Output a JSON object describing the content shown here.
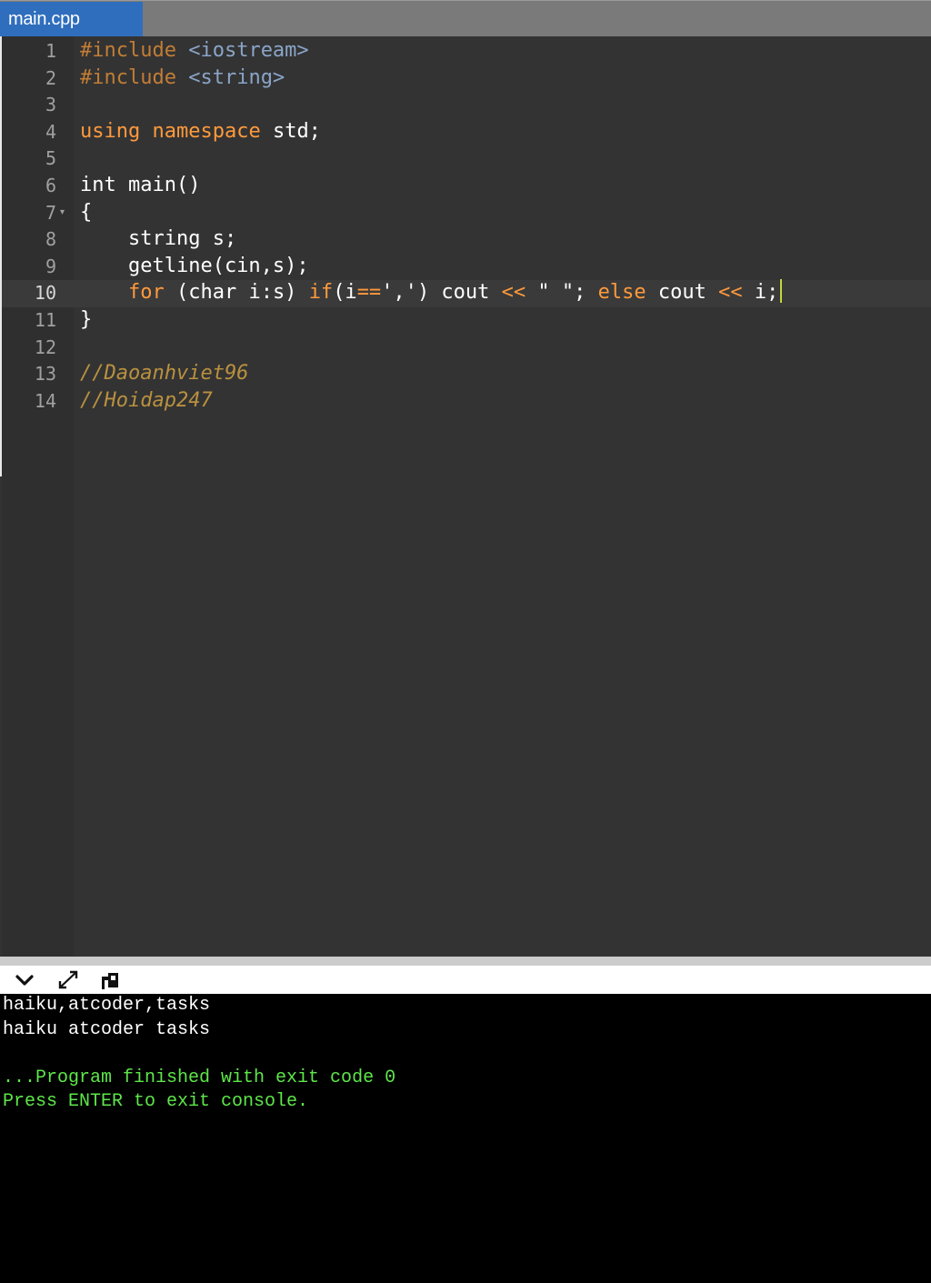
{
  "tab": {
    "title": "main.cpp"
  },
  "editor": {
    "lines": [
      {
        "num": "1",
        "tokens": [
          {
            "t": "#include ",
            "c": "tok-inc"
          },
          {
            "t": "<iostream>",
            "c": "tok-str"
          }
        ]
      },
      {
        "num": "2",
        "tokens": [
          {
            "t": "#include ",
            "c": "tok-inc"
          },
          {
            "t": "<string>",
            "c": "tok-str"
          }
        ]
      },
      {
        "num": "3",
        "tokens": []
      },
      {
        "num": "4",
        "tokens": [
          {
            "t": "using",
            "c": "tok-kw"
          },
          {
            "t": " ",
            "c": "tok-txt"
          },
          {
            "t": "namespace",
            "c": "tok-kw"
          },
          {
            "t": " std;",
            "c": "tok-txt"
          }
        ]
      },
      {
        "num": "5",
        "tokens": []
      },
      {
        "num": "6",
        "tokens": [
          {
            "t": "int main()",
            "c": "tok-txt"
          }
        ]
      },
      {
        "num": "7",
        "fold": "▾",
        "tokens": [
          {
            "t": "{",
            "c": "tok-txt"
          }
        ]
      },
      {
        "num": "8",
        "tokens": [
          {
            "t": "    string s;",
            "c": "tok-txt"
          }
        ]
      },
      {
        "num": "9",
        "tokens": [
          {
            "t": "    getline(cin,s);",
            "c": "tok-txt"
          }
        ]
      },
      {
        "num": "10",
        "active": true,
        "tokens": [
          {
            "t": "    ",
            "c": "tok-txt"
          },
          {
            "t": "for",
            "c": "tok-kw"
          },
          {
            "t": " (char i:s) ",
            "c": "tok-txt"
          },
          {
            "t": "if",
            "c": "tok-kw"
          },
          {
            "t": "(i",
            "c": "tok-txt"
          },
          {
            "t": "==",
            "c": "tok-op"
          },
          {
            "t": "','",
            "c": "tok-txt"
          },
          {
            "t": ") cout ",
            "c": "tok-txt"
          },
          {
            "t": "<<",
            "c": "tok-op"
          },
          {
            "t": " \" \"; ",
            "c": "tok-txt"
          },
          {
            "t": "else",
            "c": "tok-kw"
          },
          {
            "t": " cout ",
            "c": "tok-txt"
          },
          {
            "t": "<<",
            "c": "tok-op"
          },
          {
            "t": " i;",
            "c": "tok-txt"
          }
        ]
      },
      {
        "num": "11",
        "tokens": [
          {
            "t": "}",
            "c": "tok-txt"
          }
        ]
      },
      {
        "num": "12",
        "tokens": []
      },
      {
        "num": "13",
        "tokens": [
          {
            "t": "//Daoanhviet96",
            "c": "tok-comment"
          }
        ]
      },
      {
        "num": "14",
        "tokens": [
          {
            "t": "//Hoidap247",
            "c": "tok-comment"
          }
        ]
      }
    ]
  },
  "console_toolbar": {
    "icons": [
      "chevron-down-icon",
      "expand-icon",
      "stop-icon"
    ]
  },
  "console": {
    "lines": [
      {
        "text": "haiku,atcoder,tasks",
        "color": "white"
      },
      {
        "text": "haiku atcoder tasks",
        "color": "white"
      },
      {
        "text": "",
        "color": "white"
      },
      {
        "text": "...Program finished with exit code 0",
        "color": "green"
      },
      {
        "text": "Press ENTER to exit console.",
        "color": "green"
      }
    ]
  },
  "colors": {
    "tab_active": "#2f6ebd",
    "editor_bg": "#333333",
    "keyword": "#ff9a3c",
    "comment": "#b9913f",
    "console_text_green": "#5ee64a"
  }
}
